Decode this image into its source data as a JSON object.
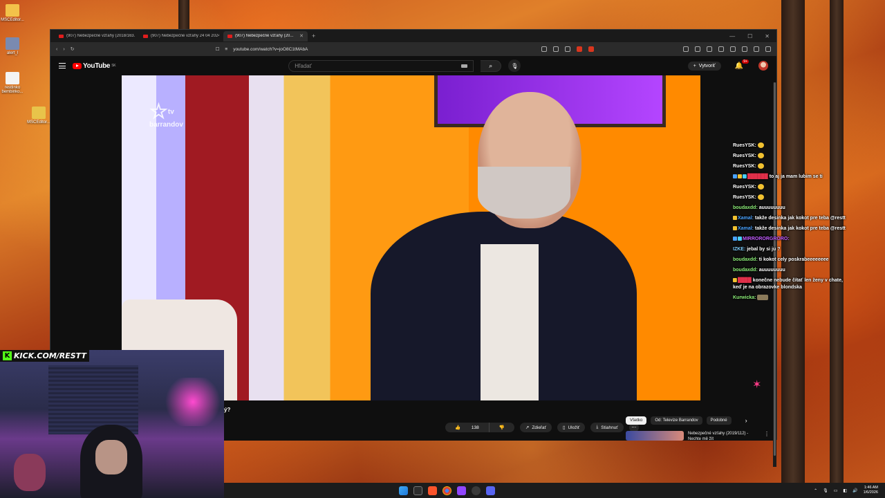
{
  "desktop": {
    "icons": [
      {
        "label": "MSCEditor..."
      },
      {
        "label": "alert_l"
      },
      {
        "label": "restlinko bembinko..."
      },
      {
        "label": "MSCEditor..."
      }
    ]
  },
  "browser": {
    "tabs": [
      {
        "label": "(907) Nebezpečné vzťahy (2018/163..."
      },
      {
        "label": "(907) Nebezpečné vzťahy 24 04 2024..."
      },
      {
        "label": "(907) Nebezpečné vzťahy (20..."
      }
    ],
    "new_tab": "+",
    "url": "youtube.com/watch?v=joO8C1tMAbA"
  },
  "youtube": {
    "logo_text": "YouTube",
    "logo_country": "SK",
    "search_placeholder": "Hľadať",
    "create_label": "Vytvoriť",
    "notifications": "9+",
    "video_logo": "barrandov",
    "video_logo_prefix": "tv",
    "title_fragment": "ý?",
    "likes": "138",
    "share_label": "Zdieľať",
    "save_label": "Uložiť",
    "download_label": "Stiahnuť",
    "chips": [
      "Všetko",
      "Od: Televize Barrandov",
      "Podobné"
    ],
    "recommendation": {
      "title": "Nebezpečné vzťahy (2019/112) - Nechte mě žít"
    }
  },
  "chat": {
    "messages": [
      {
        "user": "RuesYSK:",
        "user_color": "#ffffff",
        "text": ""
      },
      {
        "user": "RuesYSK:",
        "user_color": "#ffffff",
        "text": ""
      },
      {
        "user": "RuesYSK:",
        "user_color": "#ffffff",
        "text": ""
      },
      {
        "user": "",
        "user_color": "#e0304a",
        "text": "to aj ja mam lubim se ti"
      },
      {
        "user": "RuesYSK:",
        "user_color": "#ffffff",
        "text": ""
      },
      {
        "user": "RuesYSK:",
        "user_color": "#ffffff",
        "text": ""
      },
      {
        "user": "boudaxdd:",
        "user_color": "#8ef07a",
        "text": "auuuuuuuu"
      },
      {
        "user": "Xamal:",
        "user_color": "#4aa3ff",
        "text": "takže desinka jak kokot pre teba @restt"
      },
      {
        "user": "Xamal:",
        "user_color": "#4aa3ff",
        "text": "takže desinka jak kokot pre teba @restt"
      },
      {
        "user": "MIRRORORGRORO:",
        "user_color": "#c15cff",
        "text": ""
      },
      {
        "user": "IZKE:",
        "user_color": "#7fd0ff",
        "text": "jebal by si ju ?"
      },
      {
        "user": "boudaxdd:",
        "user_color": "#8ef07a",
        "text": "ti kokot cely poskrabeeeeeeee"
      },
      {
        "user": "boudaxdd:",
        "user_color": "#8ef07a",
        "text": "auuuuuuuu"
      },
      {
        "user": "",
        "user_color": "#e0304a",
        "text": "konečne nebude čítať len ženy v chate, keď je na obrazovke blondska"
      },
      {
        "user": "Kurwicka:",
        "user_color": "#8ef07a",
        "text": ""
      }
    ]
  },
  "stream": {
    "kick_label": "KICK.COM/RESTT",
    "kick_badge": "K"
  },
  "taskbar": {
    "time": "1:46 AM",
    "date": "1/6/2026"
  }
}
